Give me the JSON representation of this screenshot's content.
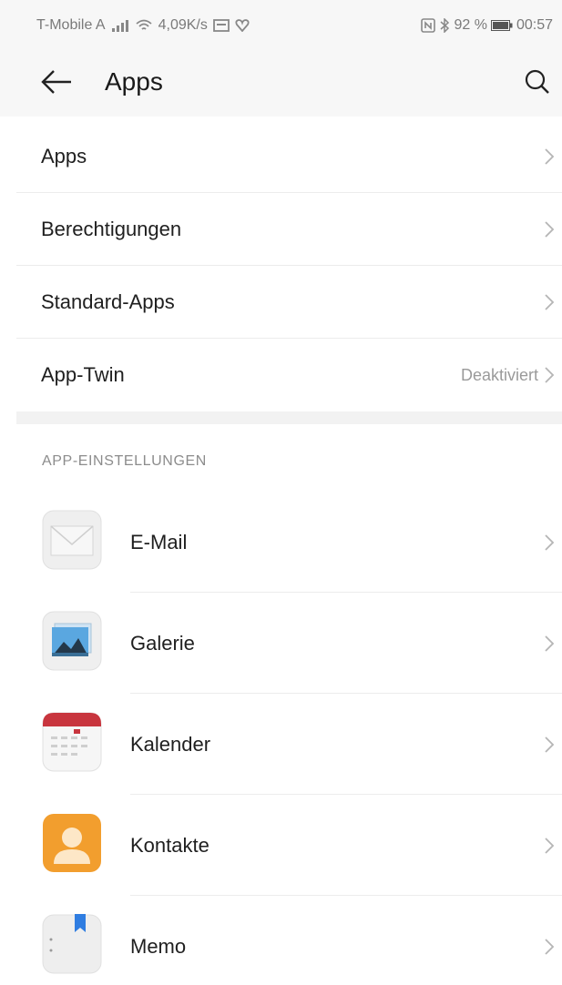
{
  "status_bar": {
    "carrier": "T-Mobile A",
    "speed": "4,09K/s",
    "battery": "92 %",
    "time": "00:57"
  },
  "app_bar": {
    "title": "Apps",
    "back_icon": "arrow-left-icon",
    "search_icon": "search-icon"
  },
  "menu": {
    "items": [
      {
        "label": "Apps",
        "value": ""
      },
      {
        "label": "Berechtigungen",
        "value": ""
      },
      {
        "label": "Standard-Apps",
        "value": ""
      },
      {
        "label": "App-Twin",
        "value": "Deaktiviert"
      }
    ]
  },
  "section": {
    "header": "APP-EINSTELLUNGEN"
  },
  "apps": {
    "items": [
      {
        "label": "E-Mail",
        "icon": "email-app-icon"
      },
      {
        "label": "Galerie",
        "icon": "gallery-app-icon"
      },
      {
        "label": "Kalender",
        "icon": "calendar-app-icon"
      },
      {
        "label": "Kontakte",
        "icon": "contacts-app-icon"
      },
      {
        "label": "Memo",
        "icon": "memo-app-icon"
      }
    ]
  },
  "colors": {
    "bar_bg": "#f7f7f7",
    "calendar_red": "#c8353e",
    "contacts_orange": "#f29e2e",
    "memo_blue": "#2f7de1"
  }
}
